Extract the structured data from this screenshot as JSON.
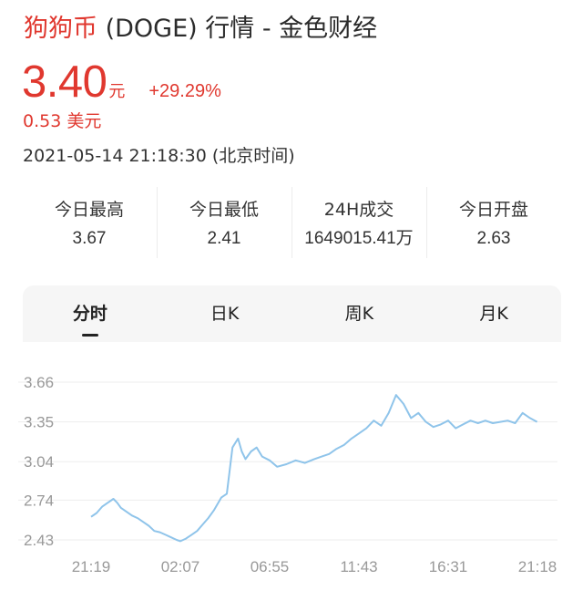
{
  "header": {
    "coin_name": "狗狗币",
    "title_rest": " (DOGE) 行情 - 金色财经"
  },
  "price": {
    "value": "3.40",
    "unit": "元",
    "change": "+29.29%",
    "usd": "0.53 美元",
    "timestamp": "2021-05-14 21:18:30 (北京时间)"
  },
  "stats": [
    {
      "label": "今日最高",
      "value": "3.67"
    },
    {
      "label": "今日最低",
      "value": "2.41"
    },
    {
      "label": "24H成交",
      "value": "1649015.41万"
    },
    {
      "label": "今日开盘",
      "value": "2.63"
    }
  ],
  "tabs": [
    {
      "label": "分时",
      "active": true
    },
    {
      "label": "日K",
      "active": false
    },
    {
      "label": "周K",
      "active": false
    },
    {
      "label": "月K",
      "active": false
    }
  ],
  "colors": {
    "accent_red": "#e0382f",
    "line_blue": "#8fc4ea",
    "grid": "#ededed",
    "axis_text": "#999999"
  },
  "chart_data": {
    "type": "line",
    "title": "",
    "xlabel": "",
    "ylabel": "",
    "x_ticks": [
      "21:19",
      "02:07",
      "06:55",
      "11:43",
      "16:31",
      "21:18"
    ],
    "y_ticks": [
      "3.66",
      "3.35",
      "3.04",
      "2.74",
      "2.43"
    ],
    "ylim": [
      2.43,
      3.66
    ],
    "grid": true,
    "series": [
      {
        "x": [
          0,
          0.3,
          0.6,
          0.9,
          1.2,
          1.4,
          1.6,
          1.9,
          2.2,
          2.5,
          2.8,
          3.1,
          3.4,
          3.7,
          4.0,
          4.3,
          4.6,
          4.8,
          5.1,
          5.4,
          5.7,
          6.0,
          6.3,
          6.6,
          7.0,
          7.3,
          7.6,
          7.9,
          8.1,
          8.3,
          8.6,
          8.9,
          9.2,
          9.6,
          10.0,
          10.5,
          11.0,
          11.5,
          12.0,
          12.4,
          12.8,
          13.2,
          13.6,
          14.0,
          14.4,
          14.8,
          15.2,
          15.6,
          16.0,
          16.4,
          16.8,
          17.2,
          17.6,
          18.0,
          18.4,
          18.8,
          19.2,
          19.6,
          20.0,
          20.4,
          20.8,
          21.2,
          21.6,
          22.0,
          22.4,
          22.8,
          23.2,
          23.6,
          23.98
        ],
        "y": [
          2.61,
          2.64,
          2.69,
          2.72,
          2.75,
          2.72,
          2.68,
          2.65,
          2.62,
          2.6,
          2.57,
          2.54,
          2.5,
          2.49,
          2.47,
          2.45,
          2.43,
          2.42,
          2.44,
          2.47,
          2.5,
          2.55,
          2.6,
          2.66,
          2.76,
          2.79,
          3.15,
          3.22,
          3.12,
          3.06,
          3.12,
          3.15,
          3.08,
          3.05,
          3.0,
          3.02,
          3.05,
          3.03,
          3.06,
          3.08,
          3.1,
          3.14,
          3.17,
          3.22,
          3.26,
          3.3,
          3.36,
          3.32,
          3.42,
          3.56,
          3.49,
          3.38,
          3.42,
          3.35,
          3.31,
          3.33,
          3.36,
          3.3,
          3.33,
          3.36,
          3.34,
          3.36,
          3.34,
          3.35,
          3.36,
          3.34,
          3.42,
          3.38,
          3.35
        ]
      }
    ]
  }
}
